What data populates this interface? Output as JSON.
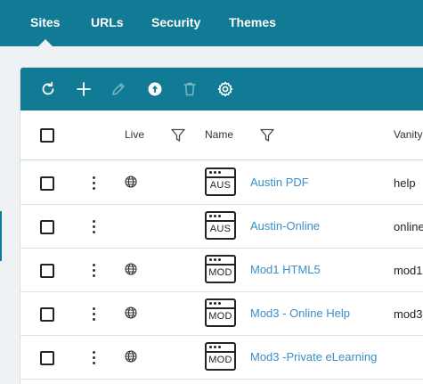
{
  "nav": {
    "tabs": [
      {
        "label": "Sites",
        "active": true
      },
      {
        "label": "URLs",
        "active": false
      },
      {
        "label": "Security",
        "active": false
      },
      {
        "label": "Themes",
        "active": false
      }
    ]
  },
  "toolbar": {
    "buttons": [
      "refresh-icon",
      "add-icon",
      "edit-icon",
      "publish-globe-icon",
      "delete-icon",
      "settings-icon"
    ]
  },
  "table": {
    "columns": {
      "live": "Live",
      "name": "Name",
      "vanity": "Vanity"
    },
    "rows": [
      {
        "icon_code": "AUS",
        "name": "Austin PDF",
        "live": true,
        "vanity": "help"
      },
      {
        "icon_code": "AUS",
        "name": "Austin-Online",
        "live": false,
        "vanity": "online"
      },
      {
        "icon_code": "MOD",
        "name": "Mod1 HTML5",
        "live": true,
        "vanity": "mod1"
      },
      {
        "icon_code": "MOD",
        "name": "Mod3 - Online Help",
        "live": true,
        "vanity": "mod3"
      },
      {
        "icon_code": "MOD",
        "name": "Mod3 -Private eLearning",
        "live": true,
        "vanity": ""
      }
    ]
  },
  "colors": {
    "brand": "#117a94",
    "link": "#3a8fc9",
    "background": "#eef2f4"
  }
}
